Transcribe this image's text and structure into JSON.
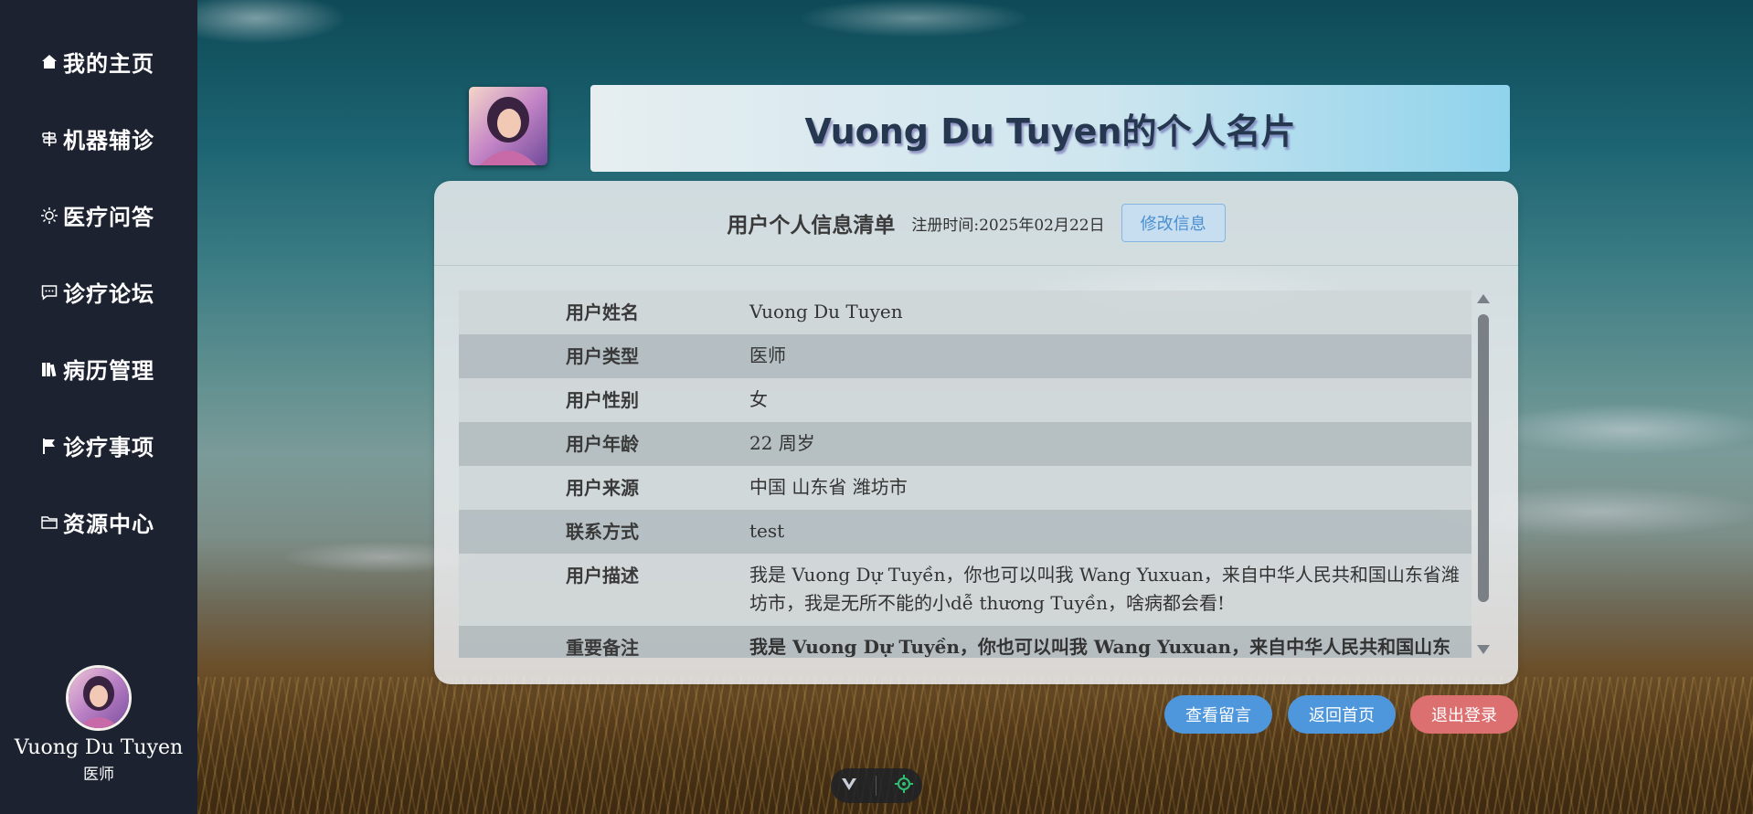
{
  "sidebar": {
    "items": [
      {
        "label": "我的主页",
        "icon": "home-icon"
      },
      {
        "label": "机器辅诊",
        "icon": "signpost-icon"
      },
      {
        "label": "医疗问答",
        "icon": "sun-icon"
      },
      {
        "label": "诊疗论坛",
        "icon": "chat-icon"
      },
      {
        "label": "病历管理",
        "icon": "books-icon"
      },
      {
        "label": "诊疗事项",
        "icon": "flag-icon"
      },
      {
        "label": "资源中心",
        "icon": "folder-icon"
      }
    ],
    "profile": {
      "name": "Vuong Du Tuyen",
      "role": "医师"
    }
  },
  "header": {
    "title": "Vuong Du Tuyen的个人名片"
  },
  "card": {
    "title": "用户个人信息清单",
    "registered_label": "注册时间:",
    "registered_value": "2025年02月22日",
    "edit_button": "修改信息",
    "rows": [
      {
        "key": "用户姓名",
        "value": "Vuong Du Tuyen"
      },
      {
        "key": "用户类型",
        "value": "医师"
      },
      {
        "key": "用户性别",
        "value": "女"
      },
      {
        "key": "用户年龄",
        "value": "22 周岁"
      },
      {
        "key": "用户来源",
        "value": "中国 山东省 潍坊市"
      },
      {
        "key": "联系方式",
        "value": "test"
      },
      {
        "key": "用户描述",
        "value": "我是 Vuong Dự Tuyền，你也可以叫我 Wang Yuxuan，来自中华人民共和国山东省潍坊市，我是无所不能的小dễ thương Tuyền，啥病都会看!"
      },
      {
        "key": "重要备注",
        "value": "我是 Vuong Dự Tuyền，你也可以叫我 Wang Yuxuan，来自中华人民共和国山东"
      }
    ]
  },
  "actions": {
    "messages": "查看留言",
    "home": "返回首页",
    "logout": "退出登录"
  },
  "colors": {
    "sidebar_bg": "#1d2230",
    "primary_button": "#4f97dc",
    "danger_button": "#dc6f6f"
  }
}
